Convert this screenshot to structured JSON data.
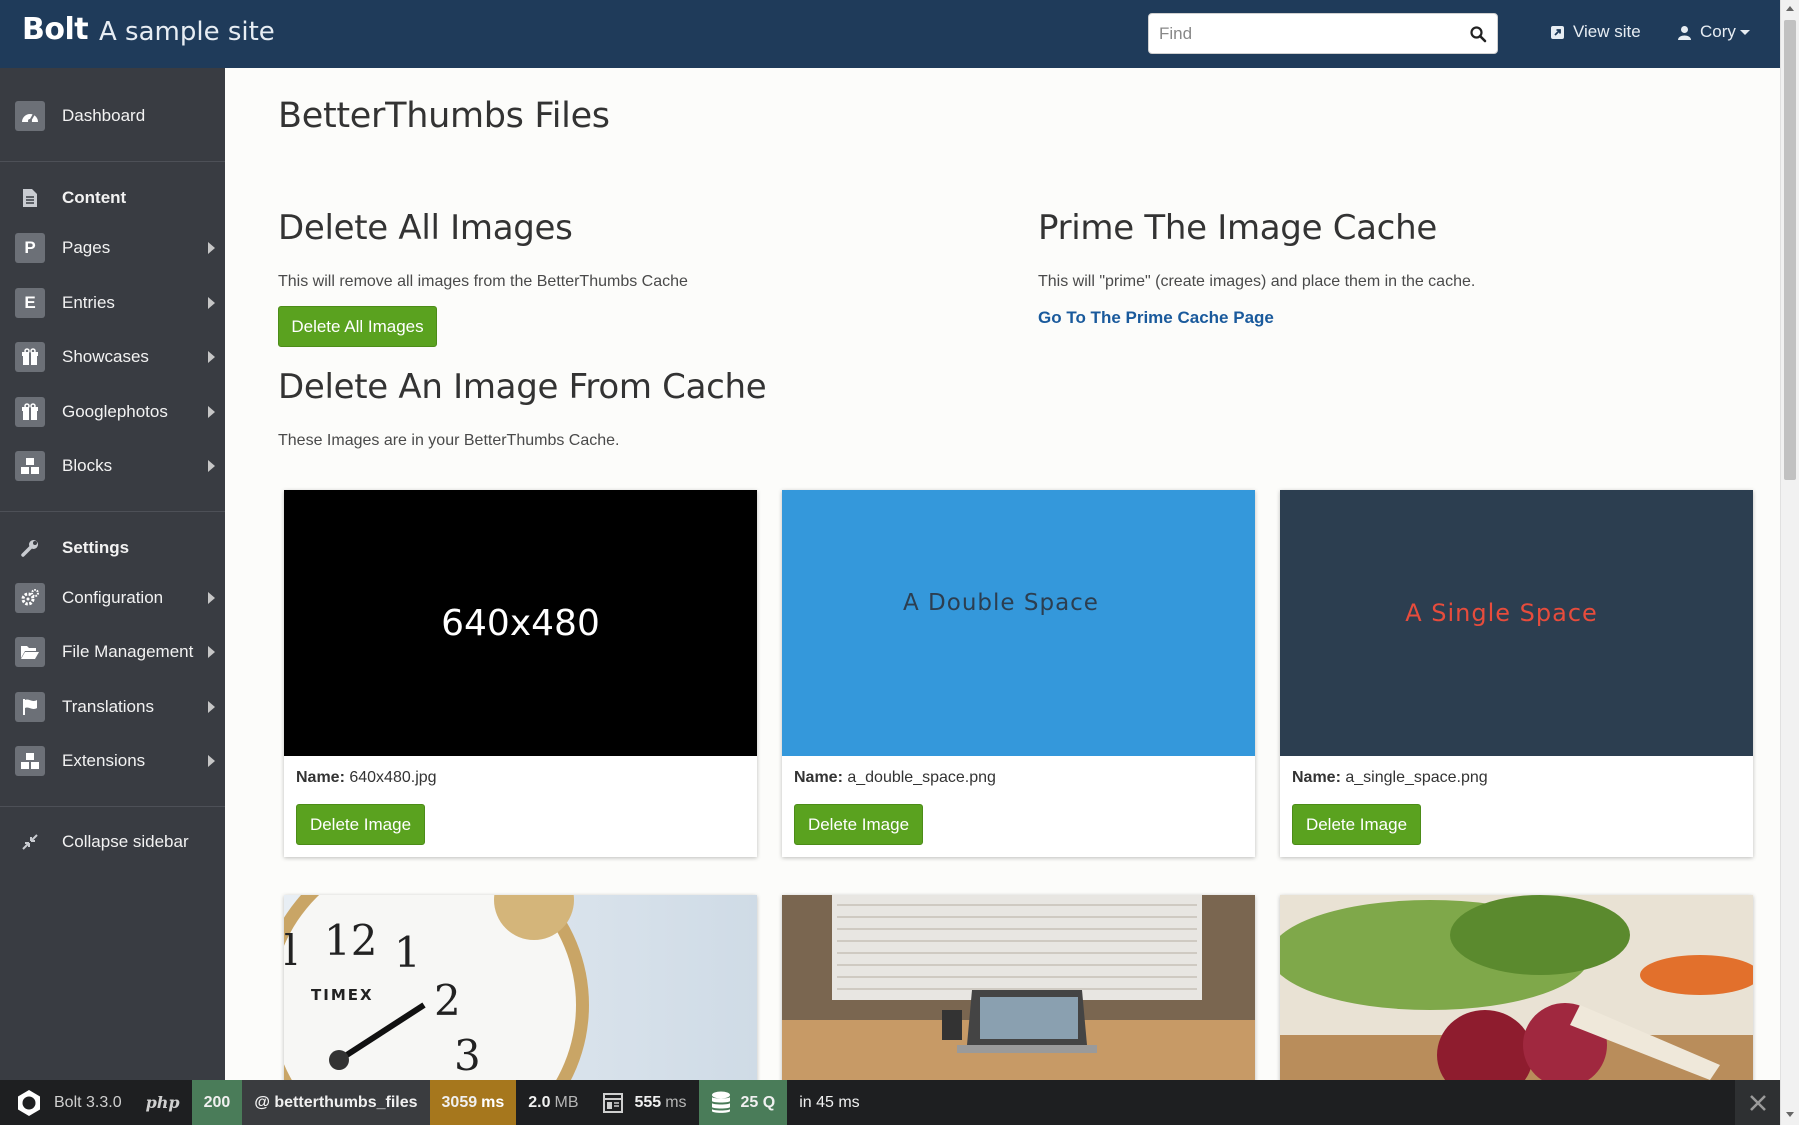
{
  "header": {
    "brand": "Bolt",
    "site_name": "A sample site",
    "search_placeholder": "Find",
    "view_site_label": "View site",
    "user_label": "Cory"
  },
  "sidebar": {
    "dashboard": "Dashboard",
    "content_heading": "Content",
    "content_items": [
      {
        "label": "Pages",
        "icon": "P"
      },
      {
        "label": "Entries",
        "icon": "E"
      },
      {
        "label": "Showcases",
        "icon": "gift-icon"
      },
      {
        "label": "Googlephotos",
        "icon": "gift-icon"
      },
      {
        "label": "Blocks",
        "icon": "cubes-icon"
      }
    ],
    "settings_heading": "Settings",
    "settings_items": [
      {
        "label": "Configuration",
        "icon": "cogs-icon"
      },
      {
        "label": "File Management",
        "icon": "folder-open-icon"
      },
      {
        "label": "Translations",
        "icon": "flag-icon"
      },
      {
        "label": "Extensions",
        "icon": "cubes-icon"
      }
    ],
    "collapse": "Collapse sidebar"
  },
  "main": {
    "title": "BetterThumbs Files",
    "delete_all": {
      "heading": "Delete All Images",
      "text": "This will remove all images from the BetterThumbs Cache",
      "button": "Delete All Images"
    },
    "prime": {
      "heading": "Prime The Image Cache",
      "text": "This will \"prime\" (create images) and place them in the cache.",
      "link": "Go To The Prime Cache Page"
    },
    "delete_one": {
      "heading": "Delete An Image From Cache",
      "text": "These Images are in your BetterThumbs Cache."
    },
    "name_label": "Name:",
    "delete_button": "Delete Image",
    "images": [
      {
        "name": "640x480.jpg",
        "thumb_text": "640x480",
        "bg": "#000000",
        "fg": "#ffffff"
      },
      {
        "name": "a_double_space.png",
        "thumb_text": "A Double Space",
        "bg": "#3498db",
        "fg": "#2c3e50"
      },
      {
        "name": "a_single_space.png",
        "thumb_text": "A Single Space",
        "bg": "#2c3e50",
        "fg": "#e74c3c"
      }
    ]
  },
  "debugbar": {
    "version": "Bolt 3.3.0",
    "php": "php",
    "status": "200",
    "route": "@ betterthumbs_files",
    "time": "3059",
    "time_unit": "ms",
    "memory": "2.0",
    "memory_unit": "MB",
    "render": "555",
    "render_unit": "ms",
    "queries": "25 Q",
    "query_time": "in 45 ms"
  }
}
